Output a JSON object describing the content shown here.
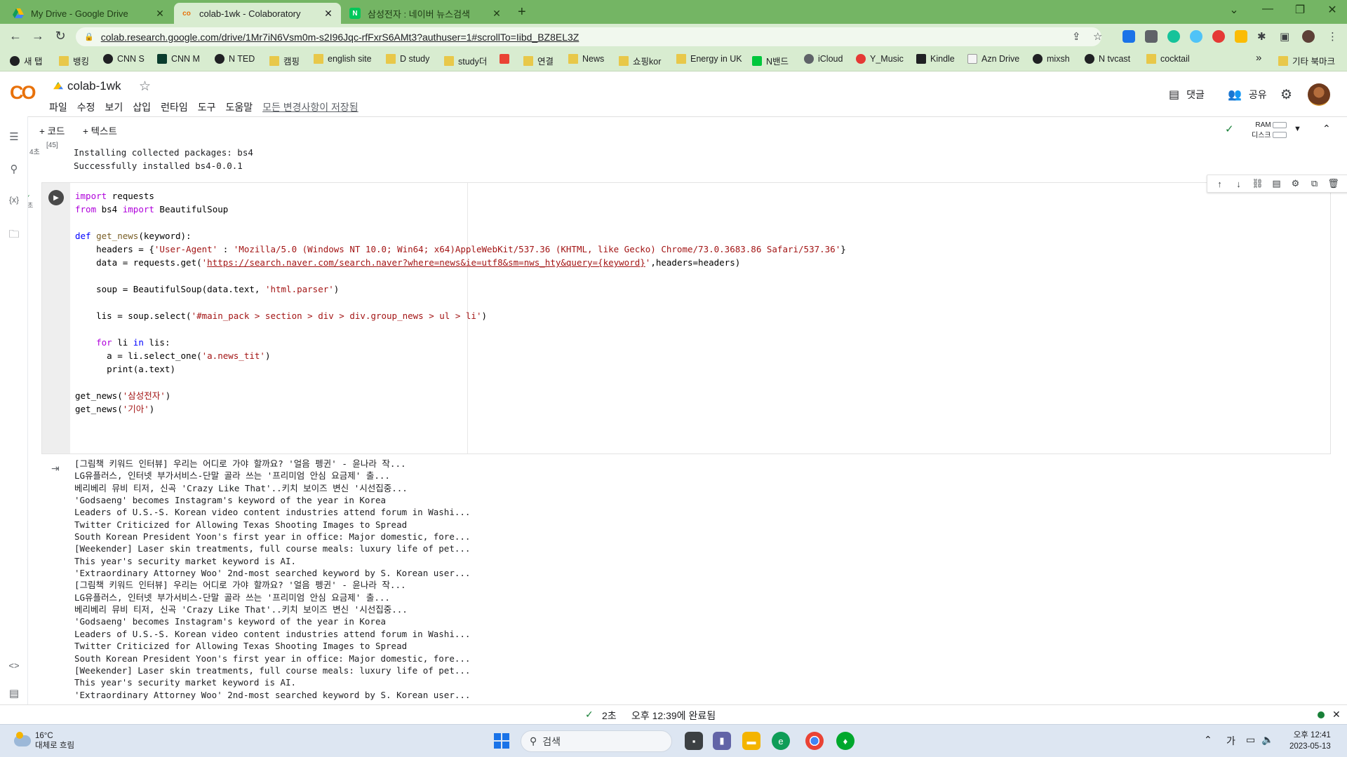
{
  "browser": {
    "tabs": [
      {
        "title": "My Drive - Google Drive",
        "icon": "google-drive-icon",
        "active": false
      },
      {
        "title": "colab-1wk - Colaboratory",
        "icon": "colab-icon",
        "active": true
      },
      {
        "title": "삼성전자 : 네이버 뉴스검색",
        "icon": "naver-icon",
        "active": false
      }
    ],
    "new_tab": "+",
    "url": "colab.research.google.com/drive/1Mr7iN6Vsm0m-s2I96Jqc-rfFxrS6AMt3?authuser=1#scrollTo=Iibd_BZ8EL3Z",
    "bookmarks": [
      "새 탭",
      "뱅킹",
      "CNN S",
      "CNN M",
      "N TED",
      "캠핑",
      "english site",
      "D study",
      "study더",
      "",
      "연결",
      "News",
      "쇼핑kor",
      "Energy in UK",
      "N밴드",
      "iCloud",
      "Y_Music",
      "Kindle",
      "Azn Drive",
      "mixsh",
      "N tvcast",
      "cocktail"
    ],
    "bookmarks_more": "»",
    "other_bookmarks": "기타 북마크"
  },
  "colab": {
    "logo": "CO",
    "notebook_name": "colab-1wk",
    "menu": [
      "파일",
      "수정",
      "보기",
      "삽입",
      "런타임",
      "도구",
      "도움말"
    ],
    "save_status": "모든 변경사항이 저장됨",
    "comment_label": "댓글",
    "share_label": "공유",
    "add_code": "+ 코드",
    "add_text": "+ 텍스트",
    "ram_label": "RAM",
    "disk_label": "디스크"
  },
  "previous_cell": {
    "exec_label": "4초",
    "number": "[45]",
    "output": [
      "Installing collected packages: bs4",
      "Successfully installed bs4-0.0.1"
    ]
  },
  "cell": {
    "exec_check": "✓",
    "exec_time": "2초",
    "code_lines": [
      "import requests",
      "from bs4 import BeautifulSoup",
      "",
      "def get_news(keyword):",
      "    headers = {'User-Agent' : 'Mozilla/5.0 (Windows NT 10.0; Win64; x64)AppleWebKit/537.36 (KHTML, like Gecko) Chrome/73.0.3683.86 Safari/537.36'}",
      "    data = requests.get('https://search.naver.com/search.naver?where=news&ie=utf8&sm=nws_hty&query={keyword}',headers=headers)",
      "",
      "    soup = BeautifulSoup(data.text, 'html.parser')",
      "",
      "    lis = soup.select('#main_pack > section > div > div.group_news > ul > li')",
      "",
      "    for li in lis:",
      "      a = li.select_one('a.news_tit')",
      "      print(a.text)",
      "",
      "get_news('삼성전자')",
      "get_news('기아')"
    ],
    "output_lines": [
      "[그림책 키워드 인터뷰] 우리는 어디로 가야 할까요? '얼음 펭귄' - 윤나라 작...",
      "LG유플러스, 인터넷 부가서비스-단말 골라 쓰는 '프리미엄 안심 요금제' 출...",
      "베리베리 뮤비 티저, 신곡 'Crazy Like That'..키치 보이즈 변신 '시선집중...",
      "'Godsaeng' becomes Instagram's keyword of the year in Korea",
      "Leaders of U.S.-S. Korean video content industries attend forum in Washi...",
      "Twitter Criticized for Allowing Texas Shooting Images to Spread",
      "South Korean President Yoon's first year in office: Major domestic, fore...",
      "[Weekender] Laser skin treatments, full course meals: luxury life of pet...",
      "This year's security market keyword is AI.",
      "'Extraordinary Attorney Woo' 2nd-most searched keyword by S. Korean user...",
      "[그림책 키워드 인터뷰] 우리는 어디로 가야 할까요? '얼음 펭귄' - 윤나라 작...",
      "LG유플러스, 인터넷 부가서비스-단말 골라 쓰는 '프리미엄 안심 요금제' 출...",
      "베리베리 뮤비 티저, 신곡 'Crazy Like That'..키치 보이즈 변신 '시선집중...",
      "'Godsaeng' becomes Instagram's keyword of the year in Korea",
      "Leaders of U.S.-S. Korean video content industries attend forum in Washi...",
      "Twitter Criticized for Allowing Texas Shooting Images to Spread",
      "South Korean President Yoon's first year in office: Major domestic, fore...",
      "[Weekender] Laser skin treatments, full course meals: luxury life of pet...",
      "This year's security market keyword is AI.",
      "'Extraordinary Attorney Woo' 2nd-most searched keyword by S. Korean user..."
    ]
  },
  "statusbar": {
    "check": "✓",
    "duration": "2초",
    "completed": "오후 12:39에 완료됨"
  },
  "taskbar": {
    "temperature": "16°C",
    "weather": "대체로 흐림",
    "search_placeholder": "검색",
    "ime": "가",
    "time": "오후 12:41",
    "date": "2023-05-13"
  }
}
